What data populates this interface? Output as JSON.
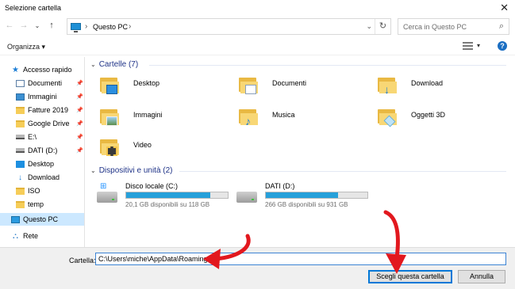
{
  "window": {
    "title": "Selezione cartella"
  },
  "nav": {
    "breadcrumb": "Questo PC",
    "search_placeholder": "Cerca in Questo PC"
  },
  "toolbar": {
    "organize": "Organizza ▾",
    "help": "?"
  },
  "sidebar": {
    "items": [
      {
        "label": "Accesso rapido",
        "icon": "star-icon",
        "pinned": false
      },
      {
        "label": "Documenti",
        "icon": "documents-icon",
        "pinned": true
      },
      {
        "label": "Immagini",
        "icon": "pictures-icon",
        "pinned": true
      },
      {
        "label": "Fatture 2019",
        "icon": "folder-icon",
        "pinned": true
      },
      {
        "label": "Google Drive",
        "icon": "folder-icon",
        "pinned": true
      },
      {
        "label": "E:\\",
        "icon": "drive-icon",
        "pinned": true
      },
      {
        "label": "DATI (D:)",
        "icon": "drive-icon",
        "pinned": true
      },
      {
        "label": "Desktop",
        "icon": "desktop-icon",
        "pinned": false
      },
      {
        "label": "Download",
        "icon": "download-icon",
        "pinned": false
      },
      {
        "label": "ISO",
        "icon": "folder-icon",
        "pinned": false
      },
      {
        "label": "temp",
        "icon": "folder-icon",
        "pinned": false
      },
      {
        "label": "Questo PC",
        "icon": "computer-icon",
        "pinned": false,
        "selected": true
      },
      {
        "label": "Rete",
        "icon": "network-icon",
        "pinned": false
      }
    ]
  },
  "content": {
    "folders_group": "Cartelle (7)",
    "folders": [
      {
        "label": "Desktop",
        "overlay": "desktop"
      },
      {
        "label": "Documenti",
        "overlay": "document"
      },
      {
        "label": "Download",
        "overlay": "download"
      },
      {
        "label": "Immagini",
        "overlay": "picture"
      },
      {
        "label": "Musica",
        "overlay": "music"
      },
      {
        "label": "Oggetti 3D",
        "overlay": "3d"
      },
      {
        "label": "Video",
        "overlay": "video"
      }
    ],
    "drives_group": "Dispositivi e unità (2)",
    "drives": [
      {
        "name": "Disco locale (C:)",
        "free": "20,1 GB disponibili su 118 GB",
        "used_fraction": 0.83,
        "windows": true
      },
      {
        "name": "DATI (D:)",
        "free": "266 GB disponibili su 931 GB",
        "used_fraction": 0.71,
        "windows": false
      }
    ]
  },
  "footer": {
    "folder_label": "Cartella:",
    "folder_value": "C:\\Users\\miche\\AppData\\Roaming",
    "select_button": "Scegli questa cartella",
    "cancel_button": "Annulla"
  },
  "colors": {
    "accent": "#0078d7",
    "annotation_arrow": "#e2181e",
    "selection": "#cce8ff"
  }
}
